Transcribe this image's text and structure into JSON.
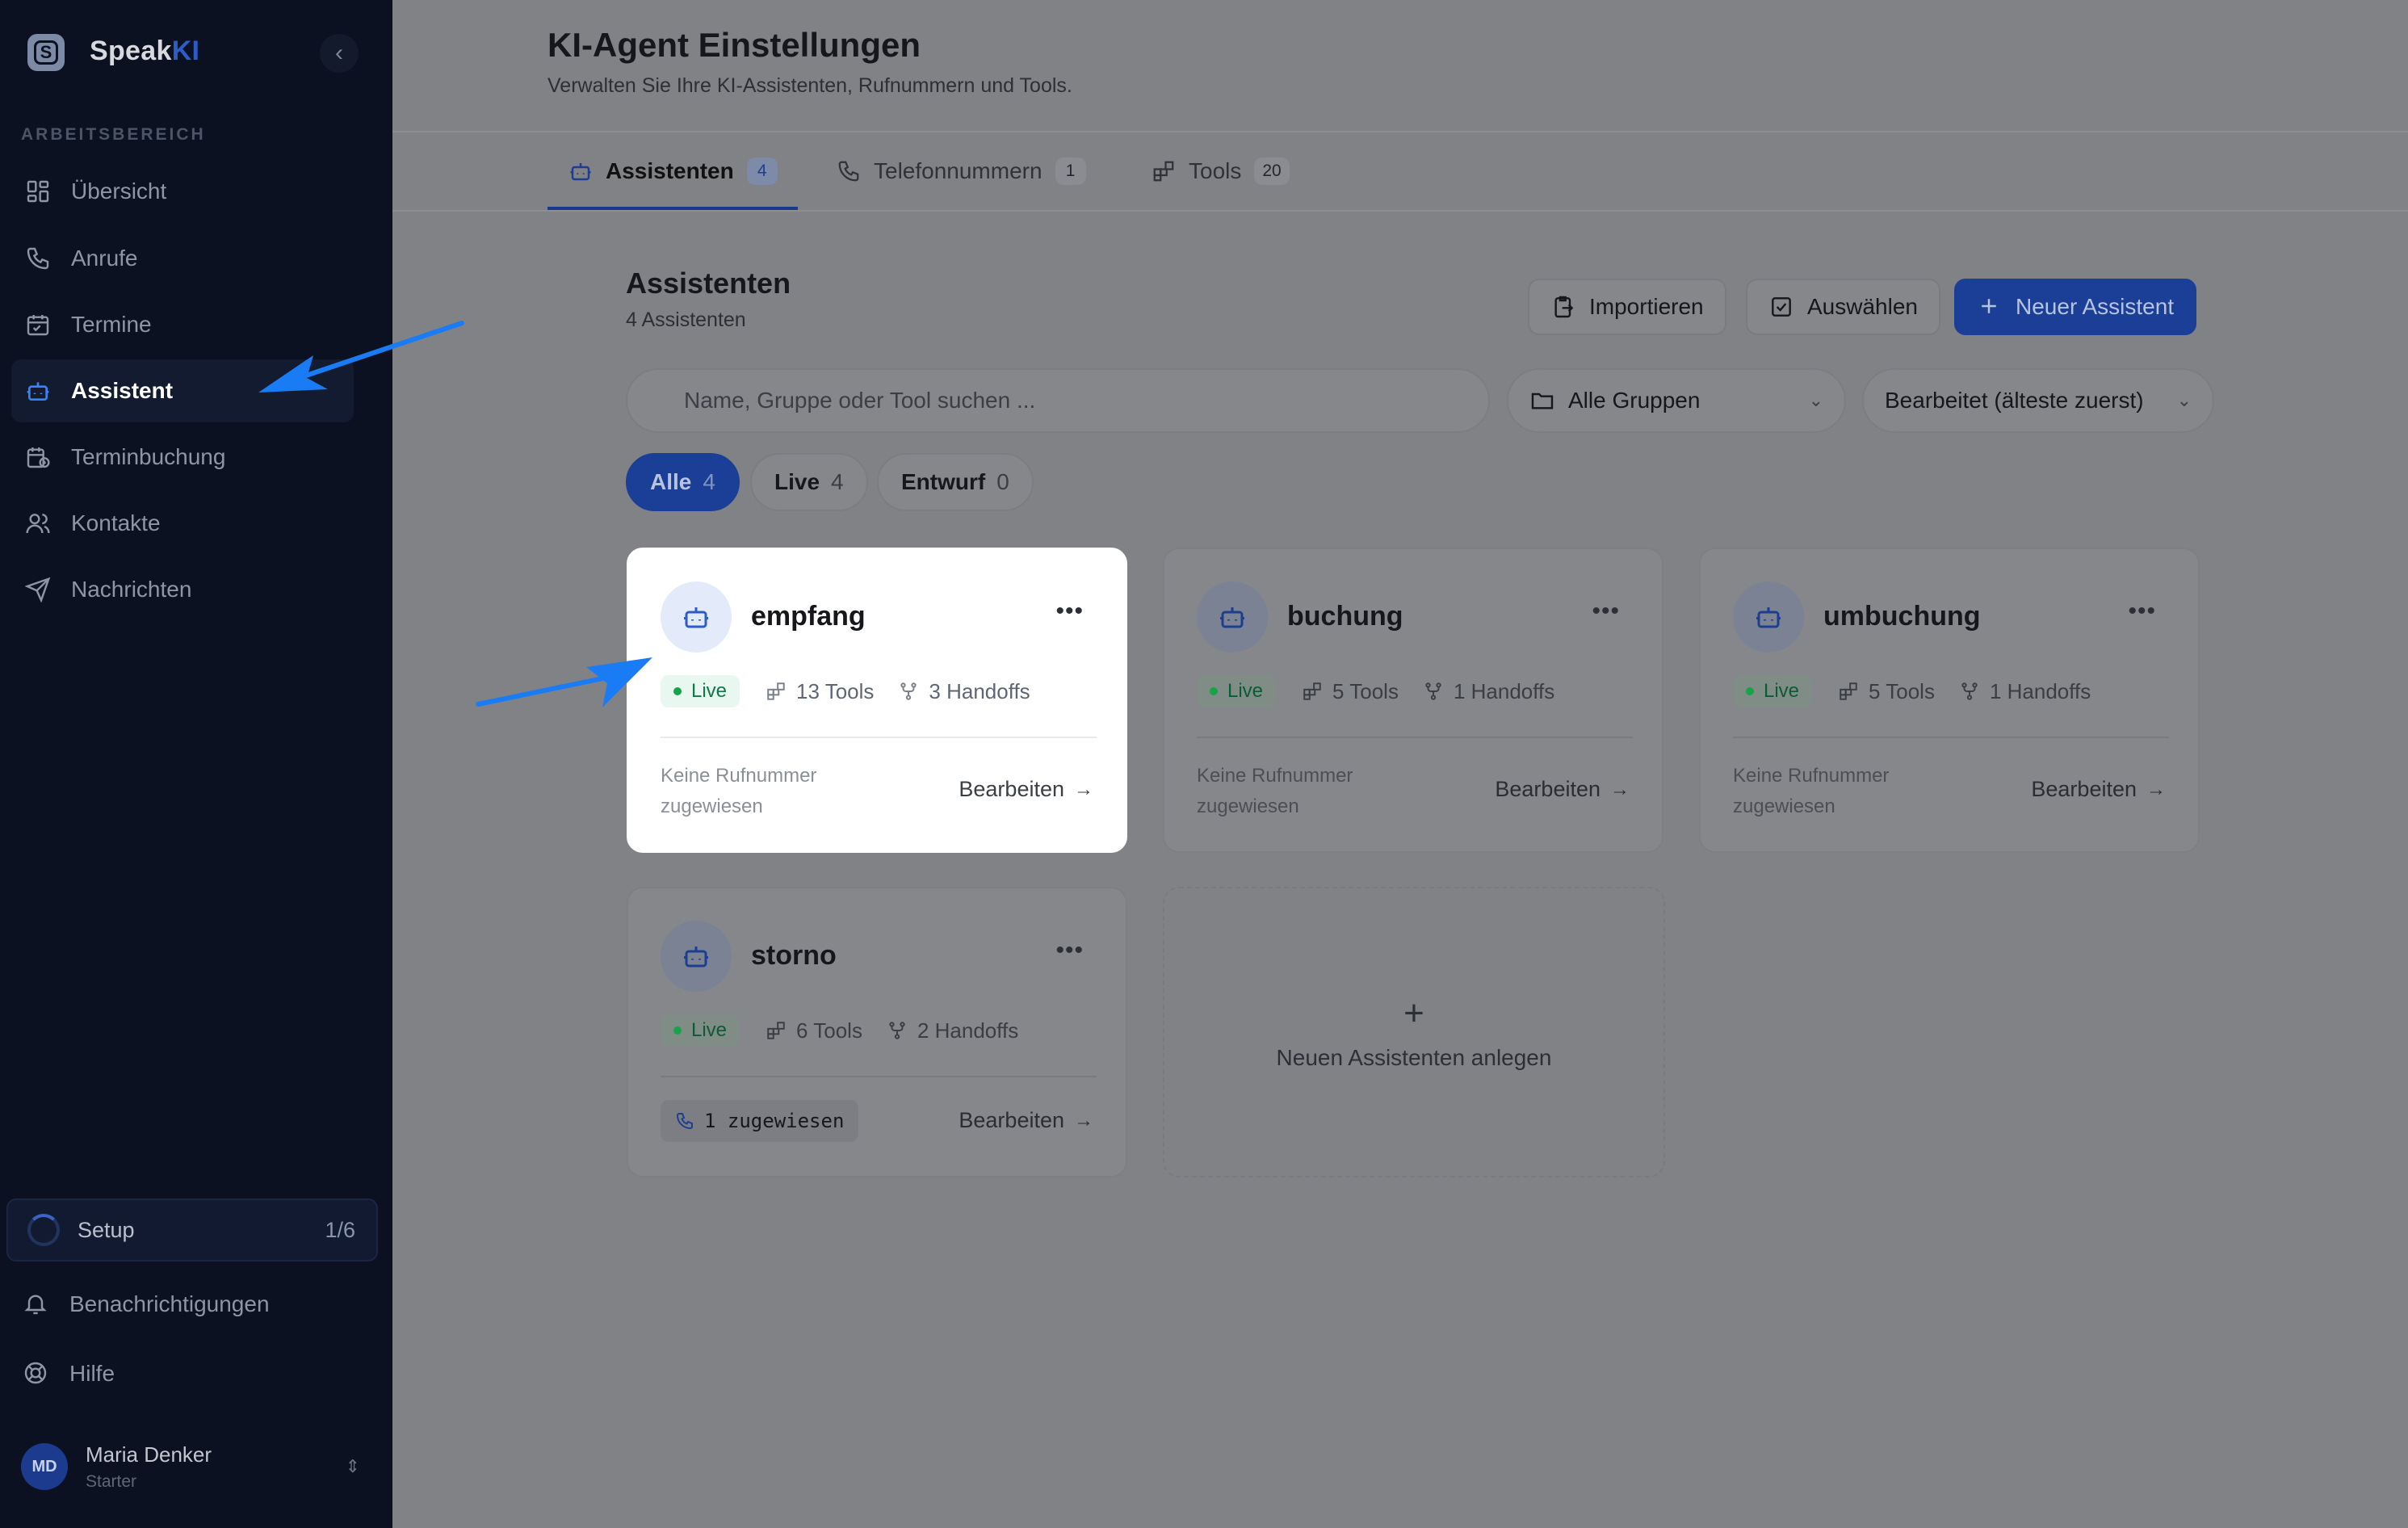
{
  "brand": {
    "name_main": "Speak",
    "name_accent": "KI"
  },
  "sidebar": {
    "section_label": "ARBEITSBEREICH",
    "items": [
      {
        "label": "Übersicht",
        "icon": "grid-icon"
      },
      {
        "label": "Anrufe",
        "icon": "phone-icon"
      },
      {
        "label": "Termine",
        "icon": "calendar-icon"
      },
      {
        "label": "Assistent",
        "icon": "bot-icon",
        "active": true
      },
      {
        "label": "Terminbuchung",
        "icon": "calendar-clock-icon"
      },
      {
        "label": "Kontakte",
        "icon": "users-icon"
      },
      {
        "label": "Nachrichten",
        "icon": "send-icon"
      }
    ],
    "setup": {
      "label": "Setup",
      "progress": "1/6"
    },
    "notifications": "Benachrichtigungen",
    "help": "Hilfe",
    "user": {
      "initials": "MD",
      "name": "Maria Denker",
      "plan": "Starter"
    }
  },
  "header": {
    "title": "KI-Agent Einstellungen",
    "subtitle": "Verwalten Sie Ihre KI-Assistenten, Rufnummern und Tools."
  },
  "tabs": [
    {
      "label": "Assistenten",
      "count": "4",
      "active": true
    },
    {
      "label": "Telefonnummern",
      "count": "1"
    },
    {
      "label": "Tools",
      "count": "20"
    }
  ],
  "section": {
    "title": "Assistenten",
    "subtitle": "4 Assistenten",
    "import_label": "Importieren",
    "select_label": "Auswählen",
    "new_label": "Neuer Assistent"
  },
  "filters": {
    "search_placeholder": "Name, Gruppe oder Tool suchen ...",
    "group_select": "Alle Gruppen",
    "sort_select": "Bearbeitet (älteste zuerst)"
  },
  "chips": [
    {
      "label": "Alle",
      "count": "4",
      "active": true
    },
    {
      "label": "Live",
      "count": "4"
    },
    {
      "label": "Entwurf",
      "count": "0"
    }
  ],
  "cards": [
    {
      "name": "empfang",
      "status": "Live",
      "tools": "13 Tools",
      "handoffs": "3 Handoffs",
      "footer": "Keine Rufnummer zugewiesen",
      "edit": "Bearbeiten"
    },
    {
      "name": "buchung",
      "status": "Live",
      "tools": "5 Tools",
      "handoffs": "1 Handoffs",
      "footer": "Keine Rufnummer zugewiesen",
      "edit": "Bearbeiten"
    },
    {
      "name": "umbuchung",
      "status": "Live",
      "tools": "5 Tools",
      "handoffs": "1 Handoffs",
      "footer": "Keine Rufnummer zugewiesen",
      "edit": "Bearbeiten"
    },
    {
      "name": "storno",
      "status": "Live",
      "tools": "6 Tools",
      "handoffs": "2 Handoffs",
      "footer": "1 zugewiesen",
      "edit": "Bearbeiten"
    }
  ],
  "new_card": {
    "plus": "+",
    "label": "Neuen Assistenten anlegen"
  },
  "colors": {
    "accent": "#1b3f96",
    "live": "#16a34a",
    "sidebar": "#0b1120",
    "annotation_arrow": "#1a7cf5"
  }
}
